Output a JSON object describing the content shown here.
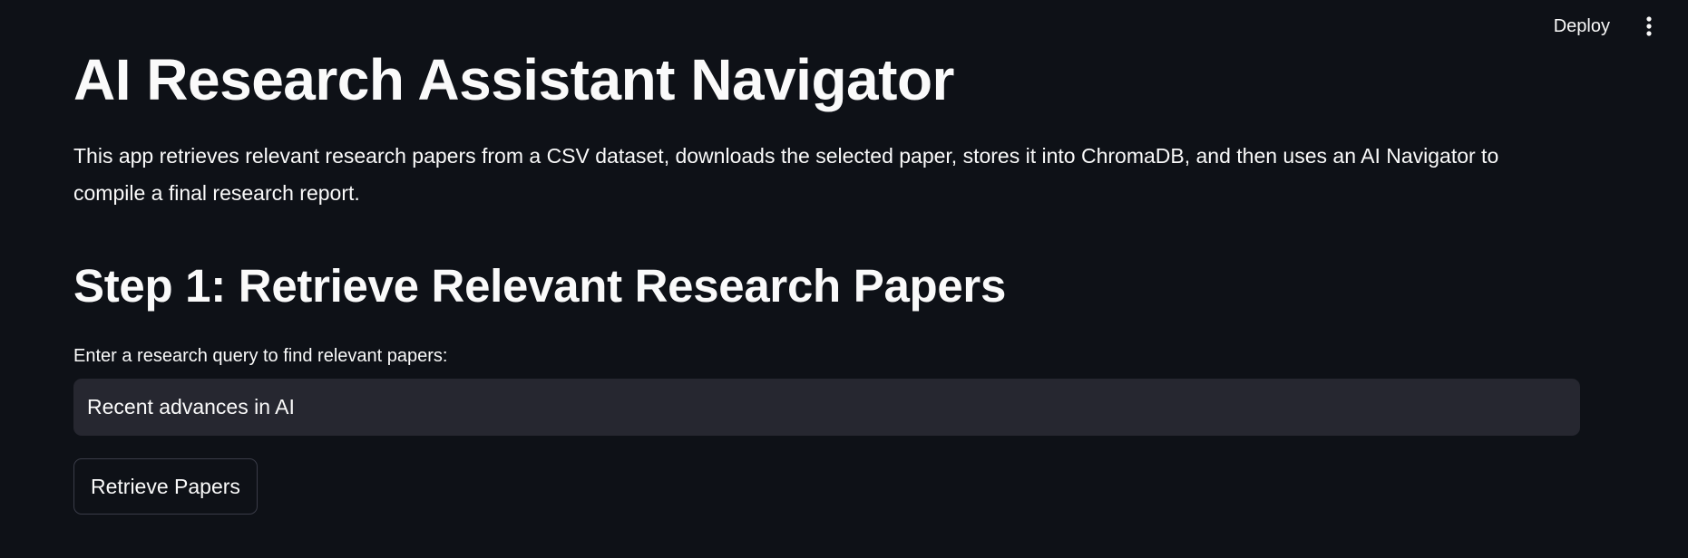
{
  "toolbar": {
    "deploy_label": "Deploy",
    "menu_icon": "vertical-ellipsis-icon"
  },
  "main": {
    "title": "AI Research Assistant Navigator",
    "intro": "This app retrieves relevant research papers from a CSV dataset, downloads the selected paper, stores it into ChromaDB, and then uses an AI Navigator to compile a final research report.",
    "step1": {
      "heading": "Step 1: Retrieve Relevant Research Papers",
      "query_label": "Enter a research query to find relevant papers:",
      "query_value": "Recent advances in AI",
      "retrieve_label": "Retrieve Papers"
    }
  },
  "colors": {
    "background": "#0e1117",
    "text": "#fafafa",
    "input_background": "#262730",
    "button_border": "#3a3c48"
  }
}
